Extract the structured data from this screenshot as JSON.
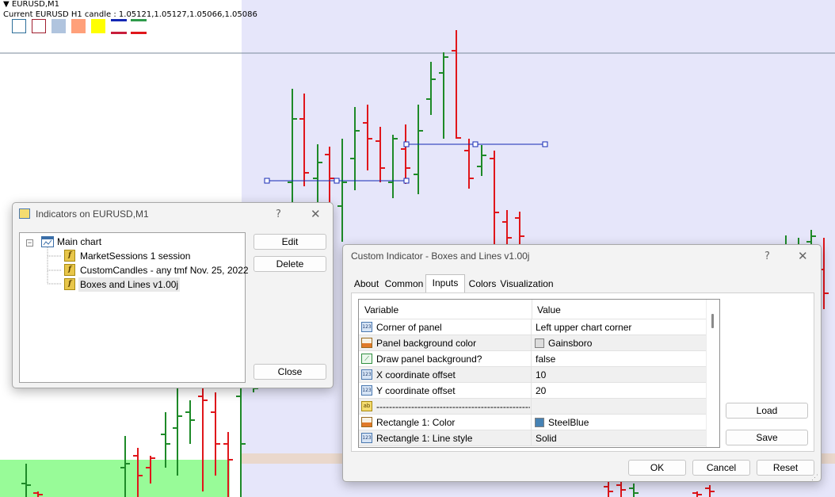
{
  "chart": {
    "symbol": "EURUSD,M1",
    "candle_info": "Current EURUSD H1 candle : 1.05121,1.05127,1.05066,1.05086",
    "colors": {
      "bull": "#1e8a28",
      "bear": "#e0161b",
      "session_bg": "#e6e6fa",
      "session_green": "#98fb98",
      "line": "#1428b4"
    }
  },
  "indicators_dialog": {
    "title": "Indicators on EURUSD,M1",
    "help": "?",
    "close": "✕",
    "tree": {
      "root": "Main chart",
      "items": [
        "MarketSessions 1 session",
        "CustomCandles - any tmf Nov. 25, 2022",
        "Boxes and Lines v1.00j"
      ]
    },
    "buttons": {
      "edit": "Edit",
      "delete": "Delete",
      "close": "Close"
    }
  },
  "custom_dialog": {
    "title": "Custom Indicator - Boxes and Lines v1.00j",
    "help": "?",
    "close": "✕",
    "tabs": [
      "About",
      "Common",
      "Inputs",
      "Colors",
      "Visualization"
    ],
    "active_tab": "Inputs",
    "columns": [
      "Variable",
      "Value"
    ],
    "rows": [
      {
        "icon": "123",
        "variable": "Corner of panel",
        "value": "Left upper chart corner"
      },
      {
        "icon": "color",
        "variable": "Panel background color",
        "value": "Gainsboro",
        "swatch": "#dcdcdc"
      },
      {
        "icon": "bool",
        "variable": "Draw panel background?",
        "value": "false"
      },
      {
        "icon": "123",
        "variable": "X coordinate offset",
        "value": "10"
      },
      {
        "icon": "123",
        "variable": "Y coordinate offset",
        "value": "20"
      },
      {
        "icon": "ab",
        "variable": "---------------------------------------------------------",
        "value": ""
      },
      {
        "icon": "color",
        "variable": "Rectangle 1: Color",
        "value": "SteelBlue",
        "swatch": "#4682b4"
      },
      {
        "icon": "123",
        "variable": "Rectangle 1: Line style",
        "value": "Solid"
      }
    ],
    "side_buttons": {
      "load": "Load",
      "save": "Save"
    },
    "bottom_buttons": {
      "ok": "OK",
      "cancel": "Cancel",
      "reset": "Reset"
    }
  }
}
